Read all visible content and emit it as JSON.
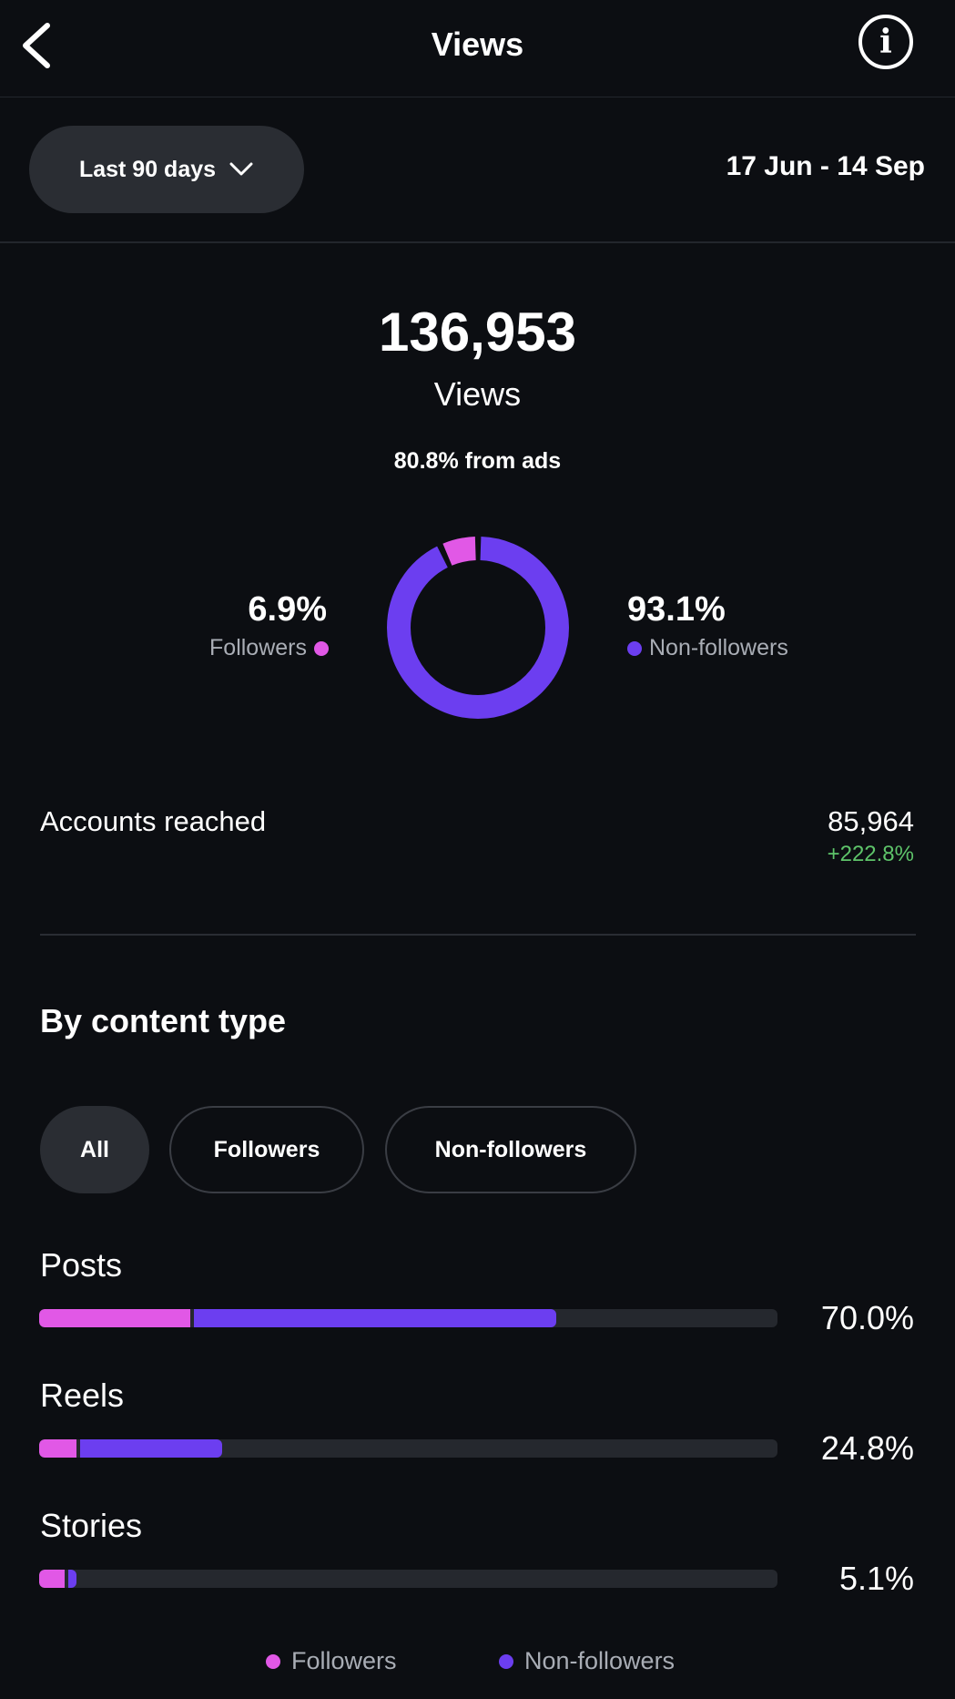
{
  "header": {
    "title": "Views",
    "back_icon": "chevron-left-icon",
    "info_icon": "info-icon"
  },
  "filter": {
    "range_label": "Last 90 days",
    "range_icon": "chevron-down-icon",
    "date_range": "17 Jun - 14 Sep"
  },
  "summary": {
    "total": "136,953",
    "total_label": "Views",
    "ads_text": "80.8% from ads"
  },
  "audience": {
    "followers_pct": "6.9%",
    "followers_label": "Followers",
    "nonfollowers_pct": "93.1%",
    "nonfollowers_label": "Non-followers",
    "followers_fraction": 0.069,
    "nonfollowers_fraction": 0.931
  },
  "accounts": {
    "label": "Accounts reached",
    "value": "85,964",
    "change": "+222.8%"
  },
  "content": {
    "title": "By content type",
    "chips": [
      "All",
      "Followers",
      "Non-followers"
    ],
    "rows": [
      {
        "label": "Posts",
        "pct": "70.0%",
        "followers_fraction": 0.205,
        "nonfollowers_fraction": 0.495
      },
      {
        "label": "Reels",
        "pct": "24.8%",
        "followers_fraction": 0.05,
        "nonfollowers_fraction": 0.198
      },
      {
        "label": "Stories",
        "pct": "5.1%",
        "followers_fraction": 0.035,
        "nonfollowers_fraction": 0.016
      }
    ]
  },
  "legend": {
    "followers": "Followers",
    "nonfollowers": "Non-followers"
  },
  "colors": {
    "followers": "#e158e6",
    "nonfollowers": "#6c3ef0",
    "positive": "#5ec46a",
    "background": "#0c0e12"
  }
}
